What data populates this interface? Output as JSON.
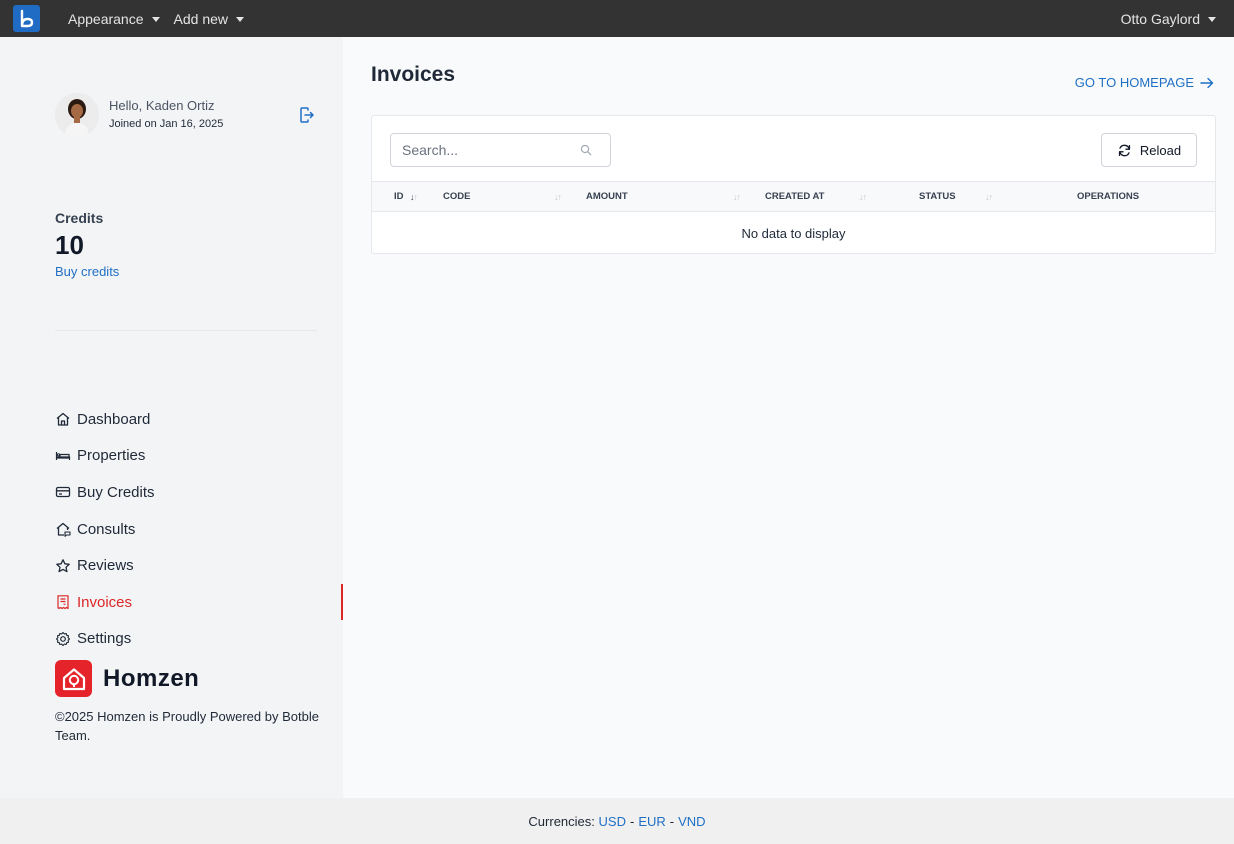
{
  "topbar": {
    "logo_letter": "b",
    "menu": [
      {
        "label": "Appearance"
      },
      {
        "label": "Add new"
      }
    ],
    "user_name": "Otto Gaylord"
  },
  "sidebar": {
    "greeting": "Hello, Kaden Ortiz",
    "joined": "Joined on Jan 16, 2025",
    "credits_label": "Credits",
    "credits_value": "10",
    "buy_credits_link": "Buy credits",
    "nav": [
      {
        "label": "Dashboard",
        "icon": "home-icon"
      },
      {
        "label": "Properties",
        "icon": "bed-icon"
      },
      {
        "label": "Buy Credits",
        "icon": "credit-card-icon"
      },
      {
        "label": "Consults",
        "icon": "house-message-icon"
      },
      {
        "label": "Reviews",
        "icon": "star-icon"
      },
      {
        "label": "Invoices",
        "icon": "invoice-icon",
        "active": true
      },
      {
        "label": "Settings",
        "icon": "gear-icon"
      }
    ],
    "brand_name": "Homzen",
    "copyright": "©2025 Homzen is Proudly Powered by Botble Team."
  },
  "main": {
    "title": "Invoices",
    "home_link": "GO TO HOMEPAGE",
    "search_placeholder": "Search...",
    "reload_label": "Reload",
    "columns": [
      "ID",
      "CODE",
      "AMOUNT",
      "CREATED AT",
      "STATUS",
      "OPERATIONS"
    ],
    "empty_message": "No data to display"
  },
  "footer": {
    "label": "Currencies:",
    "currencies": [
      "USD",
      "EUR",
      "VND"
    ]
  },
  "colors": {
    "accent": "#1f6fc5",
    "active": "#dc2626",
    "brand": "#e5232a",
    "topbar": "#333333"
  }
}
